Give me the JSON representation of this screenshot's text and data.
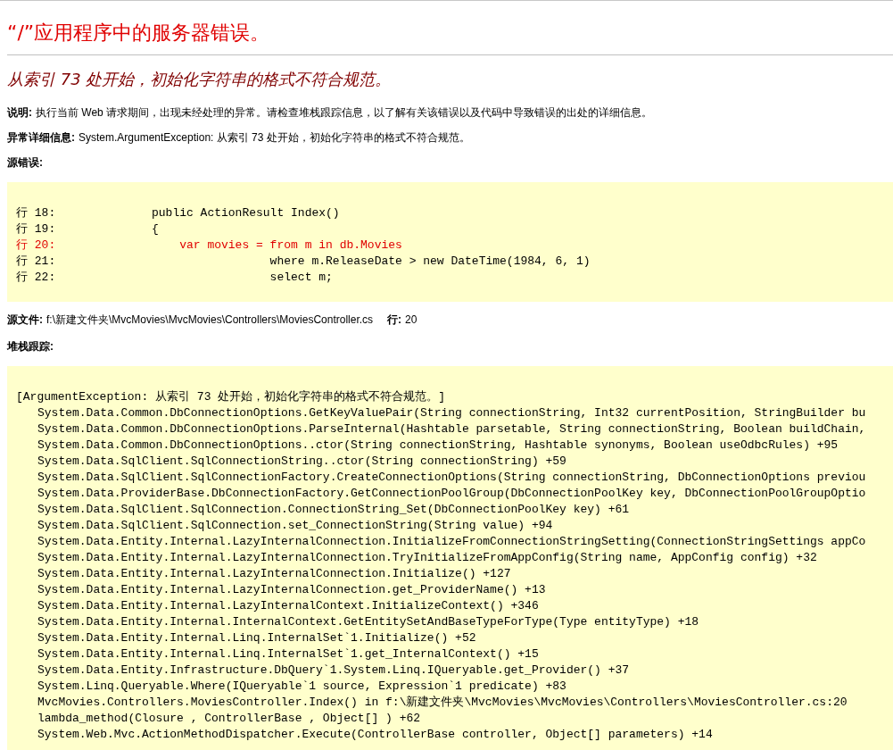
{
  "title": "“/”应用程序中的服务器错误。",
  "message": "从索引 73 处开始，初始化字符串的格式不符合规范。",
  "description": {
    "label": "说明:",
    "text": "执行当前 Web 请求期间，出现未经处理的异常。请检查堆栈跟踪信息，以了解有关该错误以及代码中导致错误的出处的详细信息。"
  },
  "exception_details": {
    "label": "异常详细信息:",
    "text": "System.ArgumentException: 从索引 73 处开始，初始化字符串的格式不符合规范。"
  },
  "source_error": {
    "label": "源错误:",
    "lines": [
      {
        "number": "行 18:",
        "code": "public ActionResult Index()",
        "highlighted": false
      },
      {
        "number": "行 19:",
        "code": "{",
        "highlighted": false
      },
      {
        "number": "行 20:",
        "code": "    var movies = from m in db.Movies",
        "highlighted": true
      },
      {
        "number": "行 21:",
        "code": "                 where m.ReleaseDate > new DateTime(1984, 6, 1)",
        "highlighted": false
      },
      {
        "number": "行 22:",
        "code": "                 select m;",
        "highlighted": false
      }
    ]
  },
  "source_file": {
    "label": "源文件:",
    "path": "f:\\新建文件夹\\MvcMovies\\MvcMovies\\Controllers\\MoviesController.cs",
    "line_label": "行:",
    "line": "20"
  },
  "stack_trace": {
    "label": "堆栈跟踪:",
    "header": "[ArgumentException: 从索引 73 处开始，初始化字符串的格式不符合规范。]",
    "lines": [
      "System.Data.Common.DbConnectionOptions.GetKeyValuePair(String connectionString, Int32 currentPosition, StringBuilder bu",
      "System.Data.Common.DbConnectionOptions.ParseInternal(Hashtable parsetable, String connectionString, Boolean buildChain,",
      "System.Data.Common.DbConnectionOptions..ctor(String connectionString, Hashtable synonyms, Boolean useOdbcRules) +95",
      "System.Data.SqlClient.SqlConnectionString..ctor(String connectionString) +59",
      "System.Data.SqlClient.SqlConnectionFactory.CreateConnectionOptions(String connectionString, DbConnectionOptions previou",
      "System.Data.ProviderBase.DbConnectionFactory.GetConnectionPoolGroup(DbConnectionPoolKey key, DbConnectionPoolGroupOptio",
      "System.Data.SqlClient.SqlConnection.ConnectionString_Set(DbConnectionPoolKey key) +61",
      "System.Data.SqlClient.SqlConnection.set_ConnectionString(String value) +94",
      "System.Data.Entity.Internal.LazyInternalConnection.InitializeFromConnectionStringSetting(ConnectionStringSettings appCo",
      "System.Data.Entity.Internal.LazyInternalConnection.TryInitializeFromAppConfig(String name, AppConfig config) +32",
      "System.Data.Entity.Internal.LazyInternalConnection.Initialize() +127",
      "System.Data.Entity.Internal.LazyInternalConnection.get_ProviderName() +13",
      "System.Data.Entity.Internal.LazyInternalContext.InitializeContext() +346",
      "System.Data.Entity.Internal.InternalContext.GetEntitySetAndBaseTypeForType(Type entityType) +18",
      "System.Data.Entity.Internal.Linq.InternalSet`1.Initialize() +52",
      "System.Data.Entity.Internal.Linq.InternalSet`1.get_InternalContext() +15",
      "System.Data.Entity.Infrastructure.DbQuery`1.System.Linq.IQueryable.get_Provider() +37",
      "System.Linq.Queryable.Where(IQueryable`1 source, Expression`1 predicate) +83",
      "MvcMovies.Controllers.MoviesController.Index() in f:\\新建文件夹\\MvcMovies\\MvcMovies\\Controllers\\MoviesController.cs:20",
      "lambda_method(Closure , ControllerBase , Object[] ) +62",
      "System.Web.Mvc.ActionMethodDispatcher.Execute(ControllerBase controller, Object[] parameters) +14"
    ]
  }
}
